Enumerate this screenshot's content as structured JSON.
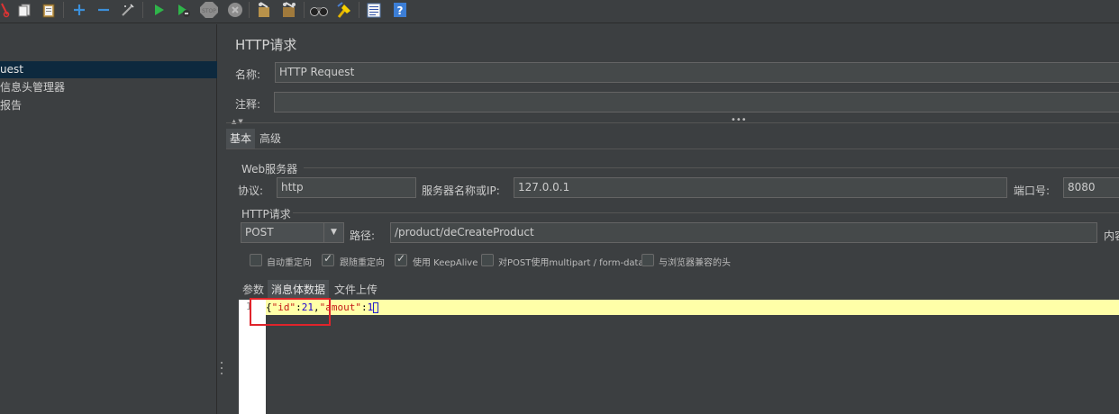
{
  "toolbar": {
    "icons": [
      "cut-icon",
      "copy-icon",
      "paste-icon",
      "add-icon",
      "remove-icon",
      "browse-icon",
      "start-icon",
      "start-no-pause-icon",
      "stop-icon",
      "shutdown-icon",
      "clear-icon",
      "clear-all-icon",
      "search-icon",
      "reset-search-icon",
      "function-helper-icon",
      "help-icon"
    ],
    "stop_label": "STOP"
  },
  "tree": {
    "items": [
      {
        "label": "uest",
        "selected": true
      },
      {
        "label": "信息头管理器",
        "selected": false
      },
      {
        "label": "报告",
        "selected": false
      }
    ]
  },
  "main": {
    "title": "HTTP请求",
    "name_label": "名称:",
    "name_value": "HTTP Request",
    "comment_label": "注释:",
    "comment_value": "",
    "tabs": [
      "基本",
      "高级"
    ],
    "web_server": {
      "group_label": "Web服务器",
      "protocol_label": "协议:",
      "protocol_value": "http",
      "server_label": "服务器名称或IP:",
      "server_value": "127.0.0.1",
      "port_label": "端口号:",
      "port_value": "8080"
    },
    "http_request": {
      "group_label": "HTTP请求",
      "method_value": "POST",
      "path_label": "路径:",
      "path_value": "/product/deCreateProduct",
      "content_label": "内容"
    },
    "checkboxes": [
      {
        "label": "自动重定向",
        "checked": false
      },
      {
        "label": "跟随重定向",
        "checked": true
      },
      {
        "label": "使用 KeepAlive",
        "checked": true
      },
      {
        "label": "对POST使用multipart / form-data",
        "checked": false
      },
      {
        "label": "与浏览器兼容的头",
        "checked": false
      }
    ],
    "body_tabs": [
      "参数",
      "消息体数据",
      "文件上传"
    ],
    "active_body_tab": "消息体数据",
    "editor": {
      "line_number": "1",
      "code_open": "{",
      "key1": "\"id\"",
      "colon1": ":",
      "val1": "21",
      "comma": ",",
      "key2": "\"amout\"",
      "colon2": ":",
      "val2": "1"
    },
    "highlight_color": "#e0242b"
  }
}
